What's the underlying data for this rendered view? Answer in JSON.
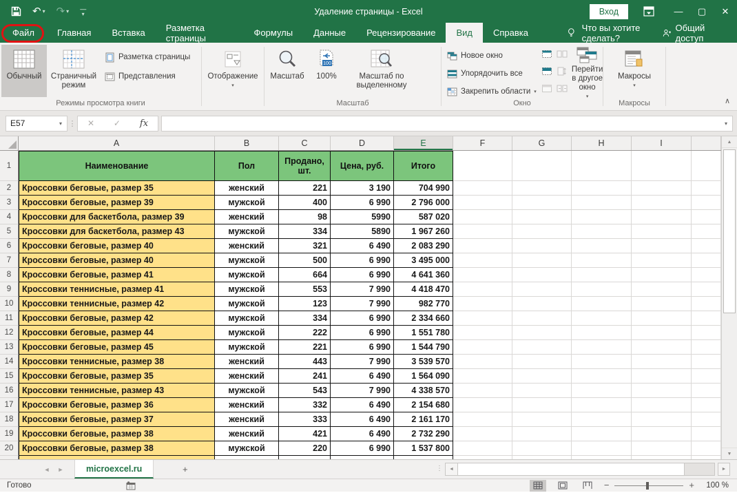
{
  "titlebar": {
    "title": "Удаление страницы - Excel",
    "signin": "Вход"
  },
  "tabs": {
    "labels": [
      "Файл",
      "Главная",
      "Вставка",
      "Разметка страницы",
      "Формулы",
      "Данные",
      "Рецензирование",
      "Вид",
      "Справка"
    ],
    "active": "Вид",
    "tell_me": "Что вы хотите сделать?",
    "share": "Общий доступ"
  },
  "ribbon": {
    "view_group": {
      "normal": "Обычный",
      "page_break_preview": "Страничный режим",
      "page_layout": "Разметка страницы",
      "custom_views": "Представления",
      "label": "Режимы просмотра книги"
    },
    "show_group": {
      "button": "Отображение"
    },
    "zoom_group": {
      "zoom": "Масштаб",
      "one_hundred": "100%",
      "zoom_to_selection": "Масштаб по выделенному",
      "label": "Масштаб",
      "badge": "100"
    },
    "window_group": {
      "new_window": "Новое окно",
      "arrange_all": "Упорядочить все",
      "freeze_panes": "Закрепить области",
      "switch_windows": "Перейти в другое окно",
      "label": "Окно"
    },
    "macros_group": {
      "macros": "Макросы",
      "label": "Макросы"
    }
  },
  "formula_bar": {
    "name_box": "E57",
    "value": ""
  },
  "sheet": {
    "column_letters": [
      "A",
      "B",
      "C",
      "D",
      "E",
      "F",
      "G",
      "H",
      "I"
    ],
    "active_column": "E",
    "table": {
      "headers": [
        "Наименование",
        "Пол",
        "Продано, шт.",
        "Цена, руб.",
        "Итого"
      ],
      "rows": [
        [
          "Кроссовки беговые, размер 35",
          "женский",
          "221",
          "3 190",
          "704 990"
        ],
        [
          "Кроссовки беговые, размер 39",
          "мужской",
          "400",
          "6 990",
          "2 796 000"
        ],
        [
          "Кроссовки для баскетбола, размер 39",
          "женский",
          "98",
          "5990",
          "587 020"
        ],
        [
          "Кроссовки для баскетбола, размер 43",
          "мужской",
          "334",
          "5890",
          "1 967 260"
        ],
        [
          "Кроссовки беговые, размер 40",
          "женский",
          "321",
          "6 490",
          "2 083 290"
        ],
        [
          "Кроссовки беговые, размер 40",
          "мужской",
          "500",
          "6 990",
          "3 495 000"
        ],
        [
          "Кроссовки беговые, размер 41",
          "мужской",
          "664",
          "6 990",
          "4 641 360"
        ],
        [
          "Кроссовки теннисные, размер 41",
          "мужской",
          "553",
          "7 990",
          "4 418 470"
        ],
        [
          "Кроссовки теннисные, размер 42",
          "мужской",
          "123",
          "7 990",
          "982 770"
        ],
        [
          "Кроссовки беговые, размер 42",
          "мужской",
          "334",
          "6 990",
          "2 334 660"
        ],
        [
          "Кроссовки беговые, размер 44",
          "мужской",
          "222",
          "6 990",
          "1 551 780"
        ],
        [
          "Кроссовки беговые, размер 45",
          "мужской",
          "221",
          "6 990",
          "1 544 790"
        ],
        [
          "Кроссовки теннисные, размер 38",
          "женский",
          "443",
          "7 990",
          "3 539 570"
        ],
        [
          "Кроссовки беговые, размер 35",
          "женский",
          "241",
          "6 490",
          "1 564 090"
        ],
        [
          "Кроссовки теннисные, размер 43",
          "мужской",
          "543",
          "7 990",
          "4 338 570"
        ],
        [
          "Кроссовки беговые, размер 36",
          "женский",
          "332",
          "6 490",
          "2 154 680"
        ],
        [
          "Кроссовки беговые, размер 37",
          "женский",
          "333",
          "6 490",
          "2 161 170"
        ],
        [
          "Кроссовки беговые, размер 38",
          "женский",
          "421",
          "6 490",
          "2 732 290"
        ],
        [
          "Кроссовки беговые, размер 38",
          "мужской",
          "220",
          "6 990",
          "1 537 800"
        ]
      ]
    }
  },
  "sheetbar": {
    "active_sheet": "microexcel.ru"
  },
  "status": {
    "ready": "Готово",
    "zoom_level": "100 %"
  },
  "colors": {
    "brand_green": "#217346",
    "header_fill": "#7cc57c",
    "row_fill": "#ffe189",
    "annotation_red": "#e01212"
  },
  "icons": {
    "undo": "↶",
    "redo": "↷",
    "dropdown": "▾",
    "minimize": "—",
    "maximize": "▢",
    "close": "✕",
    "cancel": "✕",
    "enter": "✓",
    "fx": "fx",
    "left_arrow": "◄",
    "right_arrow": "►",
    "up_arrow": "▲",
    "down_arrow": "▼",
    "add": "+",
    "splitter": "⋮",
    "collapse": "∧",
    "zoom_out": "−",
    "zoom_in": "+",
    "zoom_badge": "100"
  }
}
